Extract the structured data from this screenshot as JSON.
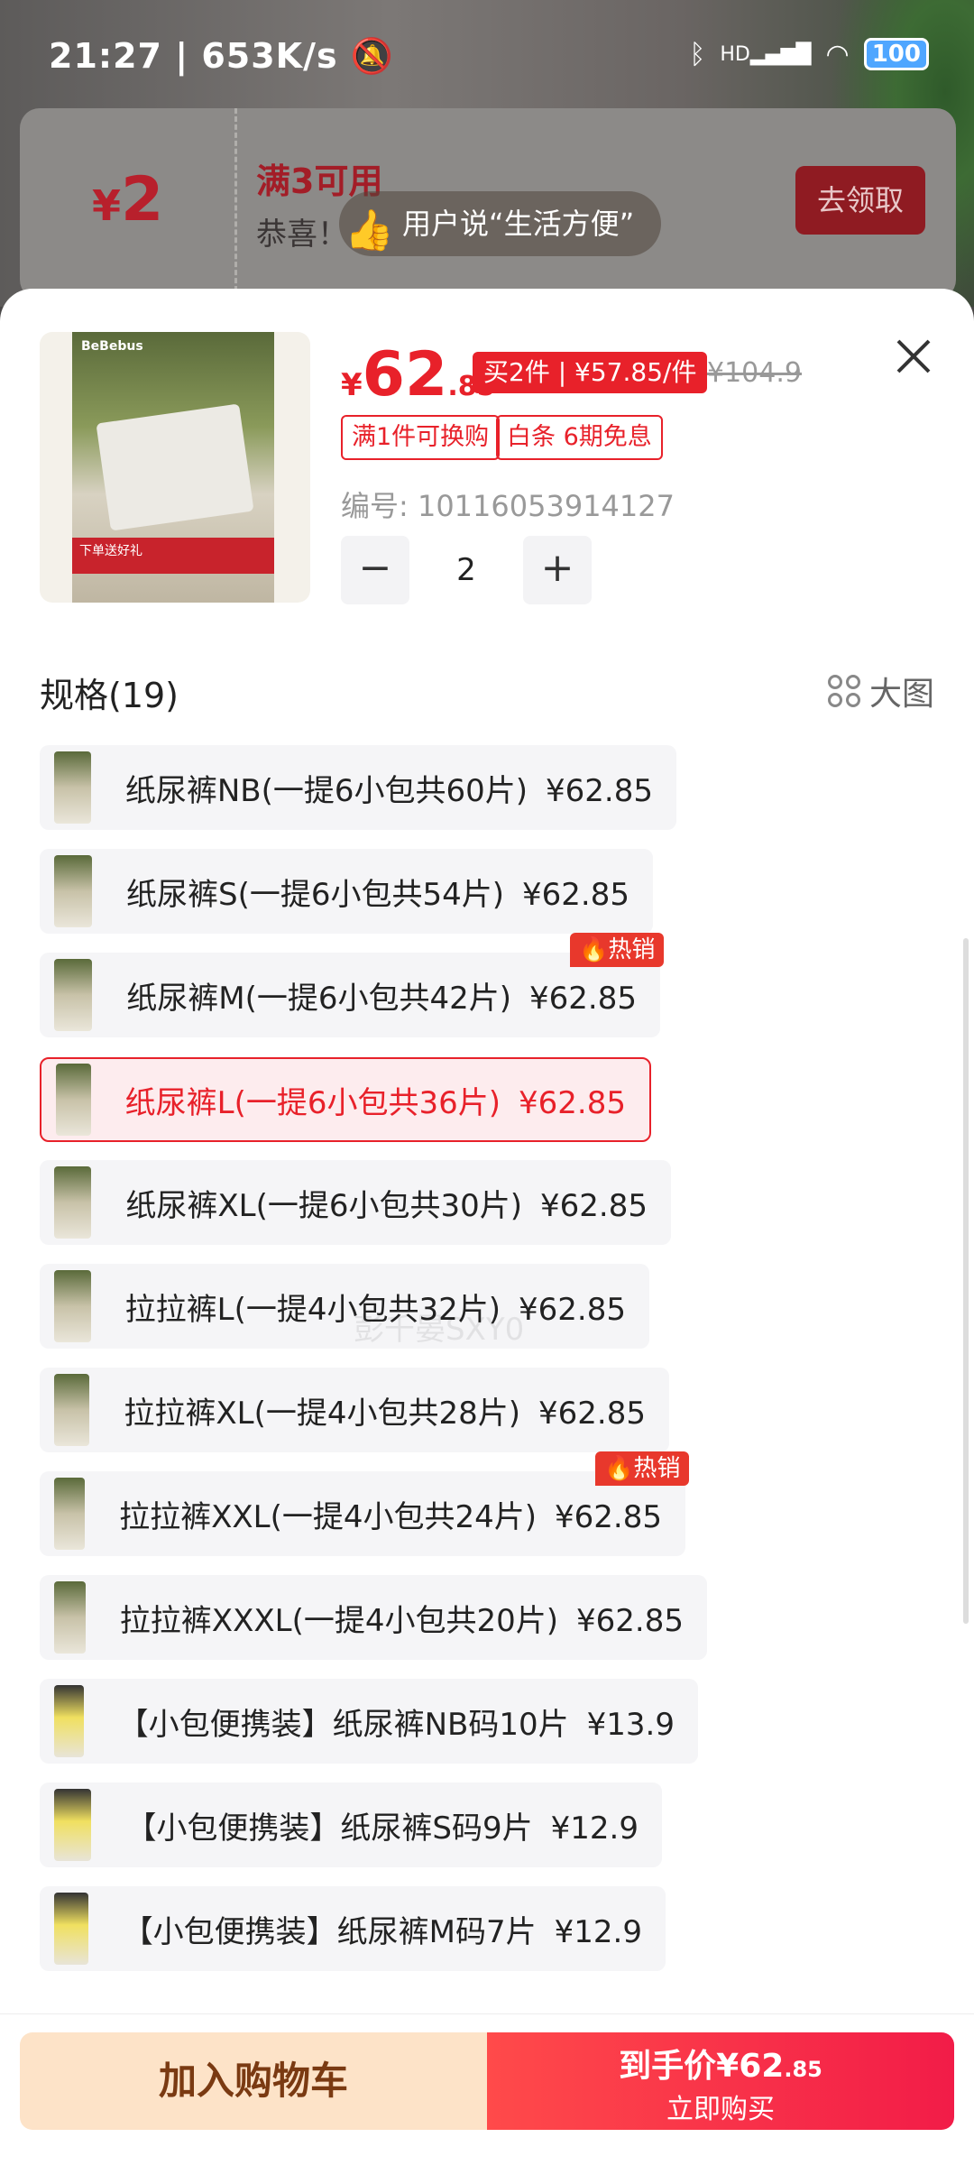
{
  "status_bar": {
    "time": "21:27",
    "speed": "653K/s",
    "battery": "100",
    "network": "HD"
  },
  "coupon": {
    "amount": "2",
    "currency": "¥",
    "title": "满3可用",
    "desc": "恭喜！",
    "button": "去领取"
  },
  "toast": {
    "text": "用户说“生活方便”"
  },
  "product": {
    "image_brand": "BeBebus",
    "image_promo": "下单送好礼",
    "currency": "¥",
    "price_int": "62",
    "price_dec": ".85",
    "multi_buy": "买2件 | ¥57.85/件",
    "original_price": "¥104.9",
    "tags": [
      "满1件可换购",
      "白条 6期免息"
    ],
    "sku_label": "编号: 10116053914127",
    "quantity": "2"
  },
  "spec": {
    "title": "规格(19)",
    "big_view": "大图"
  },
  "hot_label": "热销",
  "options": [
    {
      "name": "纸尿裤NB(一提6小包共60片)",
      "price": "¥62.85",
      "hot": false,
      "selected": false
    },
    {
      "name": "纸尿裤S(一提6小包共54片)",
      "price": "¥62.85",
      "hot": false,
      "selected": false
    },
    {
      "name": "纸尿裤M(一提6小包共42片)",
      "price": "¥62.85",
      "hot": true,
      "selected": false
    },
    {
      "name": "纸尿裤L(一提6小包共36片)",
      "price": "¥62.85",
      "hot": false,
      "selected": true
    },
    {
      "name": "纸尿裤XL(一提6小包共30片)",
      "price": "¥62.85",
      "hot": false,
      "selected": false
    },
    {
      "name": "拉拉裤L(一提4小包共32片)",
      "price": "¥62.85",
      "hot": false,
      "selected": false
    },
    {
      "name": "拉拉裤XL(一提4小包共28片)",
      "price": "¥62.85",
      "hot": false,
      "selected": false
    },
    {
      "name": "拉拉裤XXL(一提4小包共24片)",
      "price": "¥62.85",
      "hot": true,
      "selected": false
    },
    {
      "name": "拉拉裤XXXL(一提4小包共20片)",
      "price": "¥62.85",
      "hot": false,
      "selected": false
    },
    {
      "name": "【小包便携装】纸尿裤NB码10片",
      "price": "¥13.9",
      "hot": false,
      "selected": false
    },
    {
      "name": "【小包便携装】纸尿裤S码9片",
      "price": "¥12.9",
      "hot": false,
      "selected": false
    },
    {
      "name": "【小包便携装】纸尿裤M码7片",
      "price": "¥12.9",
      "hot": false,
      "selected": false
    }
  ],
  "watermark": "彭千晏SXY0",
  "bottom": {
    "add_cart": "加入购物车",
    "final_price_label": "到手价",
    "final_price_int": "¥62",
    "final_price_dec": ".85",
    "buy_now": "立即购买"
  }
}
